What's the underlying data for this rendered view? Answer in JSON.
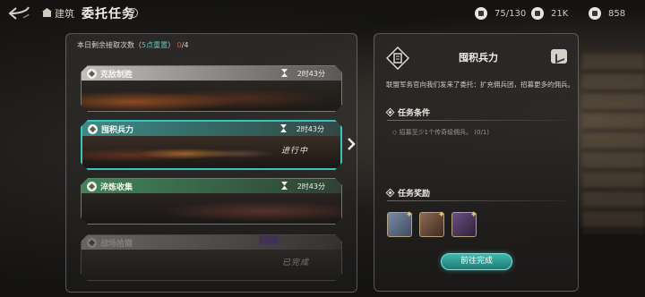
{
  "topbar": {
    "crumb": "建筑",
    "title": "委托任务",
    "help": "?",
    "resources": [
      {
        "icon": "population-icon",
        "value": "75/130"
      },
      {
        "icon": "tower-icon",
        "value": "21K"
      },
      {
        "icon": "gem-icon",
        "value": "858"
      }
    ]
  },
  "daily": {
    "prefix": "本日剩余接取次数（",
    "reset": "5点重置",
    "suffix": "）",
    "used": "0",
    "total": "/4"
  },
  "missions": [
    {
      "name": "克敌制胜",
      "time": "2时43分",
      "status": ""
    },
    {
      "name": "囤积兵力",
      "time": "2时43分",
      "status": "进行中"
    },
    {
      "name": "淬炼收集",
      "time": "2时43分",
      "status": ""
    },
    {
      "name": "战场拾掇",
      "time": "",
      "status": "已完成"
    }
  ],
  "detail": {
    "title": "囤积兵力",
    "description": "联盟军务官向我们发来了委托：扩充佣兵团，招募更多的佣兵。",
    "conditions_title": "任务条件",
    "condition": "招募至少1个传奇级佣兵。 (0/1)",
    "rewards_title": "任务奖励",
    "rewards": [
      {
        "icon": "reward-scroll-icon"
      },
      {
        "icon": "reward-chest-icon"
      },
      {
        "icon": "reward-chest-purple-icon"
      }
    ],
    "go_button": "前往完成"
  },
  "colors": {
    "accent": "#3ac4bd",
    "highlight_text": "#59c9c0",
    "warning_text": "#e2524c"
  }
}
